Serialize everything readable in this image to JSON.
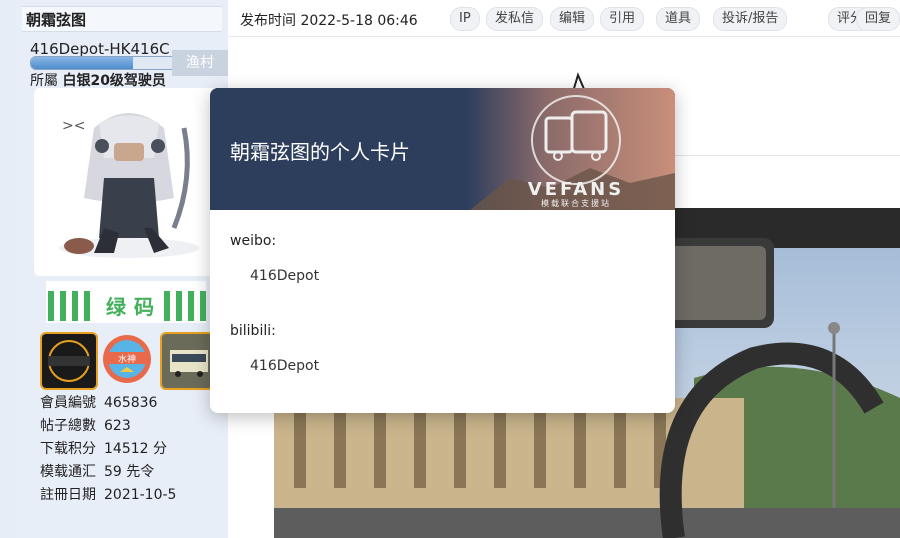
{
  "sidebar": {
    "username": "朝霜弦图",
    "user_title": "416Depot-HK416C",
    "level_progress": 0.64,
    "group_button": "渔村",
    "group_prefix": "所屬",
    "group_name": "白银20级驾驶员",
    "green_code": "绿码",
    "medals": [
      "euro-truck-medal",
      "water-god-medal",
      "bus-medal"
    ],
    "medal_badge_text": "水神",
    "stats": [
      {
        "label": "會員編號",
        "value": "465836"
      },
      {
        "label": "帖子總數",
        "value": "623"
      },
      {
        "label": "下载积分",
        "value": "14512 分"
      },
      {
        "label": "模载通汇",
        "value": "59 先令"
      },
      {
        "label": "註冊日期",
        "value": "2021-10-5"
      }
    ]
  },
  "post": {
    "time_label": "发布时间",
    "time_value": "2022-5-18 06:46",
    "actions": [
      "IP",
      "发私信",
      "编辑",
      "引用",
      "道具",
      "投诉/报告",
      "评分",
      "回复"
    ]
  },
  "card": {
    "title": "朝霜弦图的个人卡片",
    "logo_text": "VEFANS",
    "logo_subtext": "模载联合支援站",
    "fields": [
      {
        "label": "weibo:",
        "value": "416Depot"
      },
      {
        "label": "bilibili:",
        "value": "416Depot"
      }
    ]
  },
  "colors": {
    "card_header": "#2d3e5d",
    "sidebar_bg": "#e8eef7",
    "green_code": "#43b05c"
  }
}
